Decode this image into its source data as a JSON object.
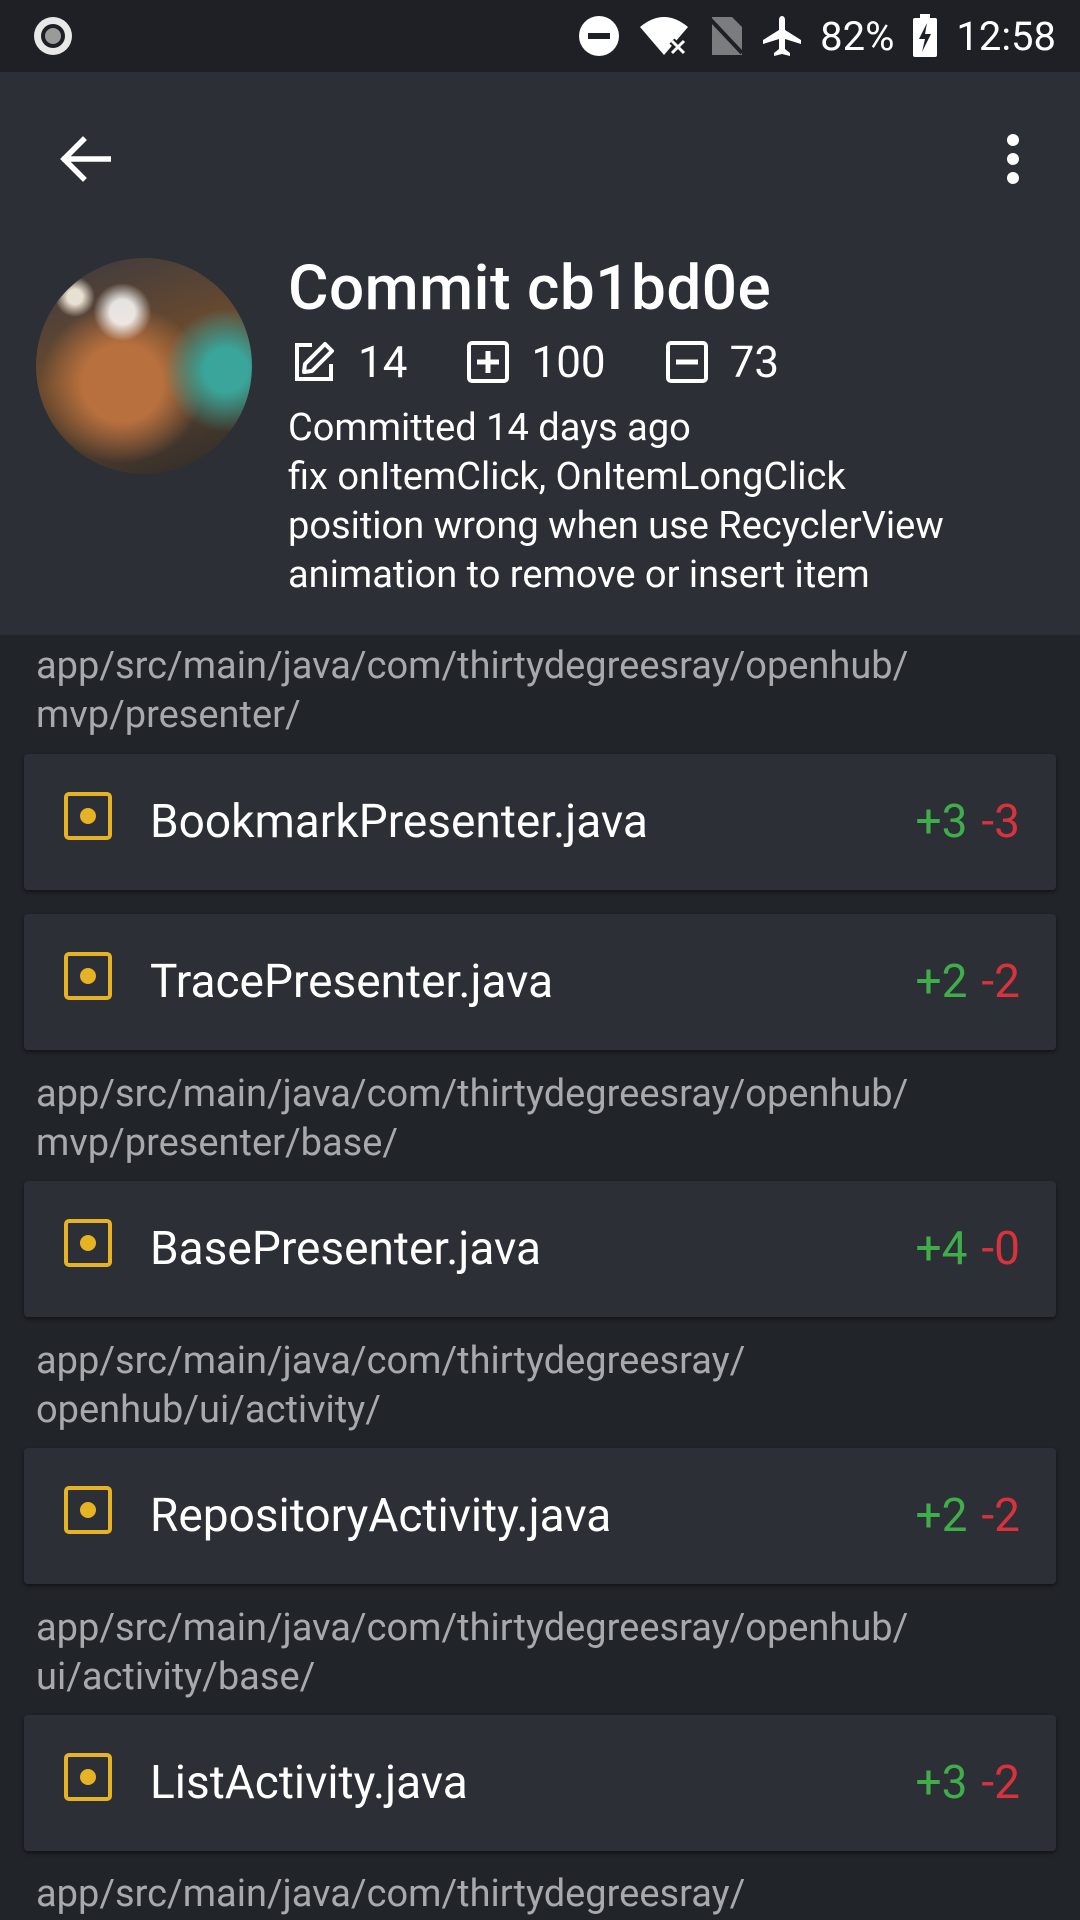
{
  "status_bar": {
    "battery": "82%",
    "time": "12:58"
  },
  "header": {
    "title": "Commit cb1bd0e",
    "stats": {
      "changed": "14",
      "added": "100",
      "removed": "73"
    },
    "committed": "Committed 14 days ago",
    "message_lines": [
      "fix onItemClick, OnItemLongClick",
      "position wrong when use RecyclerView",
      "animation to remove or insert item"
    ]
  },
  "groups": [
    {
      "path": [
        "app/src/main/java/com/thirtydegreesray/openhub/",
        "mvp/presenter/"
      ]
    },
    {
      "path": [
        "app/src/main/java/com/thirtydegreesray/openhub/",
        "mvp/presenter/base/"
      ]
    },
    {
      "path": [
        "app/src/main/java/com/thirtydegreesray/",
        "openhub/ui/activity/"
      ]
    },
    {
      "path": [
        "app/src/main/java/com/thirtydegreesray/openhub/",
        "ui/activity/base/"
      ]
    },
    {
      "path": [
        "app/src/main/java/com/thirtydegreesray/"
      ]
    }
  ],
  "files": [
    {
      "name": "BookmarkPresenter.java",
      "additions": "+3",
      "deletions": "-3"
    },
    {
      "name": "TracePresenter.java",
      "additions": "+2",
      "deletions": "-2"
    },
    {
      "name": "BasePresenter.java",
      "additions": "+4",
      "deletions": "-0"
    },
    {
      "name": "RepositoryActivity.java",
      "additions": "+2",
      "deletions": "-2"
    },
    {
      "name": "ListActivity.java",
      "additions": "+3",
      "deletions": "-2"
    }
  ],
  "icons": {
    "back": "arrow-left-icon",
    "menu": "more-vert-icon",
    "changed": "edit-icon",
    "added": "plus-box-icon",
    "removed": "minus-box-icon",
    "file": "file-modified-icon"
  },
  "colors": {
    "background": "#212429",
    "header": "#2c2f35",
    "addition": "#3fae4a",
    "deletion": "#d8323c",
    "file_icon": "#e6b422",
    "path_text": "#a7a9ad"
  }
}
